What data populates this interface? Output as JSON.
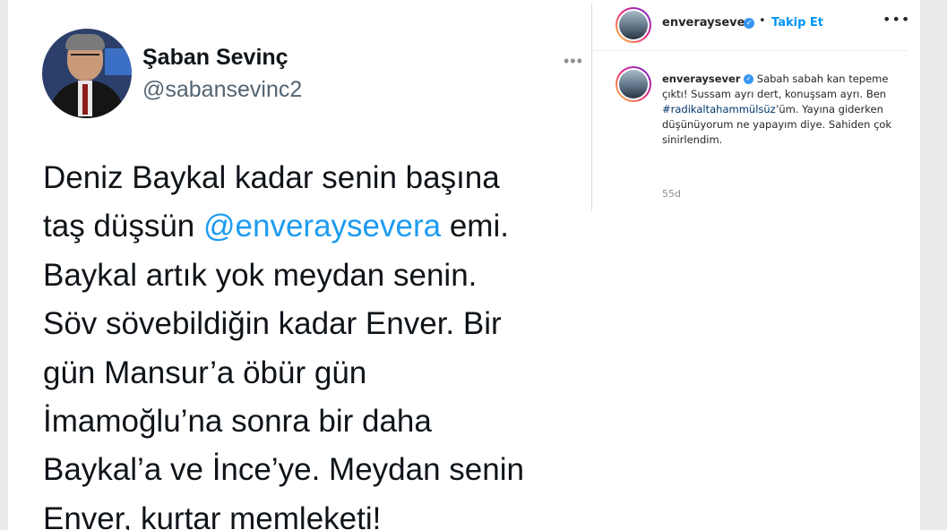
{
  "tweet": {
    "display_name": "Şaban Sevinç",
    "handle": "@sabansevinc2",
    "more_icon": "•••",
    "text_lines": [
      {
        "pre": "Deniz Baykal kadar senin başına",
        "mention": "",
        "post": ""
      },
      {
        "pre": "taş düşsün ",
        "mention": "@enveraysevera",
        "post": " emi."
      },
      {
        "pre": "Baykal artık yok meydan senin.",
        "mention": "",
        "post": ""
      },
      {
        "pre": "Söv sövebildiğin kadar Enver. Bir",
        "mention": "",
        "post": ""
      },
      {
        "pre": "gün Mansur’a öbür gün",
        "mention": "",
        "post": ""
      },
      {
        "pre": "İmamoğlu’na sonra bir daha",
        "mention": "",
        "post": ""
      },
      {
        "pre": "Baykal’a ve İnce’ye. Meydan senin",
        "mention": "",
        "post": ""
      },
      {
        "pre": "Enver, kurtar memleketi!",
        "mention": "",
        "post": ""
      }
    ],
    "mention_color": "#1d9bf0"
  },
  "instagram": {
    "username": "enveraysever",
    "verified_mark": "✓",
    "separator": "•",
    "follow_label": "Takip Et",
    "more_icon": "•••",
    "caption": {
      "username": "enveraysever",
      "text_before": "Sabah sabah kan tepeme çıktı! Sussam ayrı dert, konuşsam ayrı. Ben ",
      "hashtag": "#radikaltahammülsüz",
      "text_after": "’üm. Yayına giderken düşünüyorum ne yapayım diye. Sahiden çok sinirlendim."
    },
    "time_ago": "55d",
    "accent_color": "#0095f6"
  }
}
